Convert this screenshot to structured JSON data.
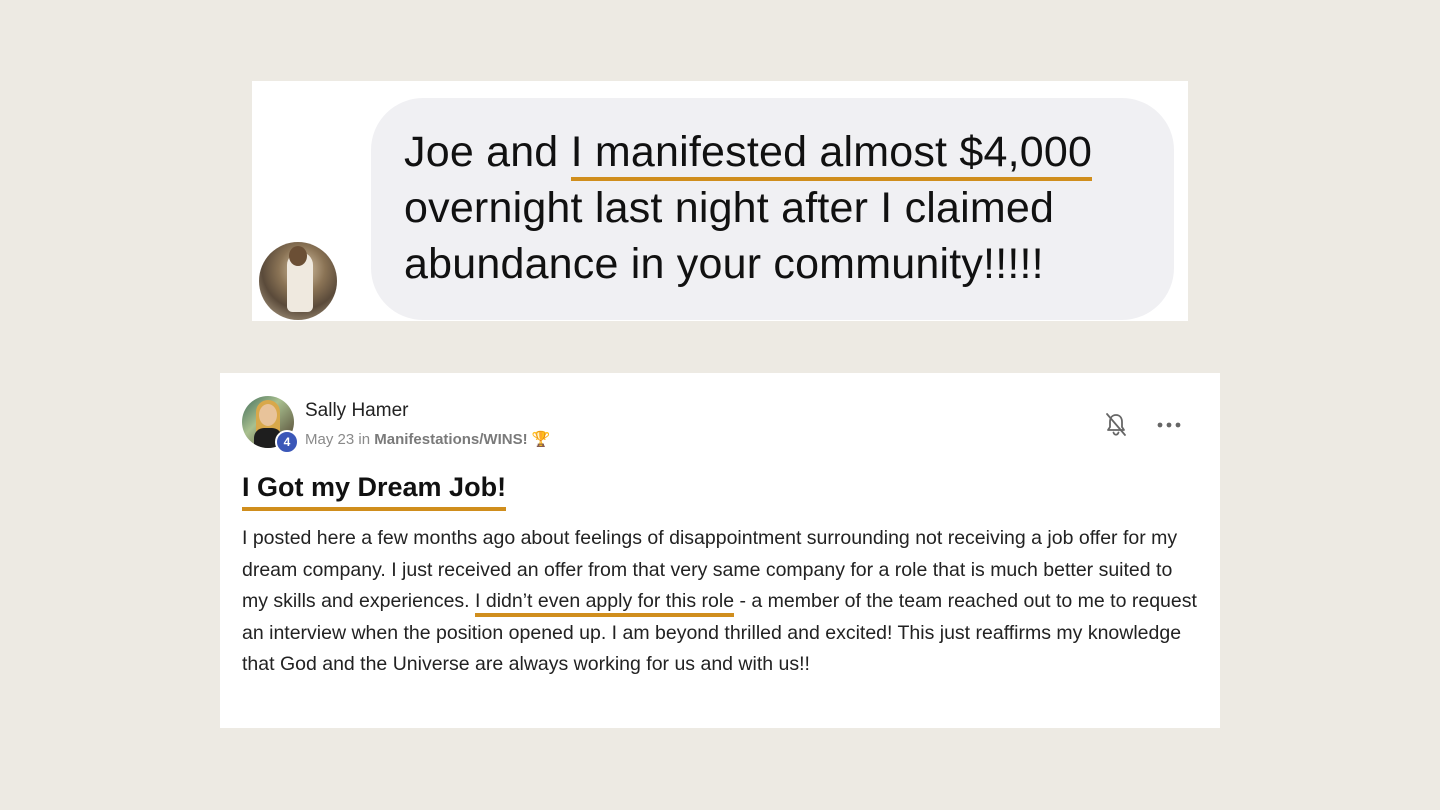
{
  "message": {
    "text_before": "Joe and ",
    "text_highlight": "I manifested almost $4,000",
    "text_after": " overnight last night after I claimed abundance in your community!!!!!"
  },
  "post": {
    "author": "Sally Hamer",
    "level": "4",
    "date": "May 23",
    "in_word": "in",
    "category": "Manifestations/WINS!",
    "category_emoji": "🏆",
    "title": "I Got my Dream Job!",
    "body_before": "I posted here a few months ago about feelings of disappointment surrounding not receiving a job offer for my dream company. I just received an offer from that very same company for a role that is much better suited to my skills and experiences. ",
    "body_highlight": "I didn’t even apply for this role",
    "body_after": " - a member of the team reached out to me to request an interview when the position opened up. I am beyond thrilled and excited! This just reaffirms my knowledge that God and the Universe are always working for us and with us!!",
    "icons": {
      "notify": "bell-off-icon",
      "more": "more-horizontal-icon"
    }
  },
  "colors": {
    "page_background": "#edeae3",
    "highlight_underline": "#d08e1d",
    "bubble_background": "#f0f0f3",
    "level_badge": "#3b57b8"
  }
}
